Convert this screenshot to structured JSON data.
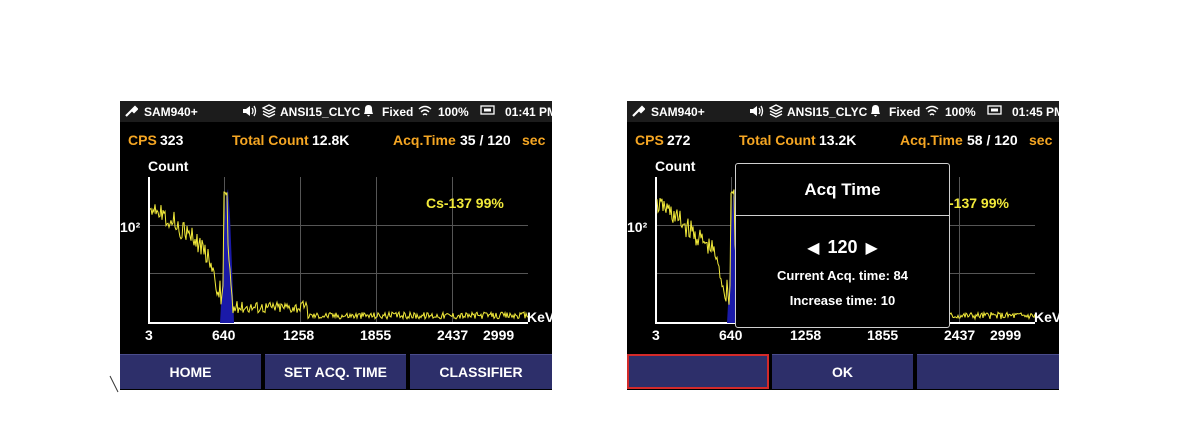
{
  "screens": [
    {
      "status": {
        "device": "SAM940+",
        "library": "ANSI15_CLYC",
        "mode": "Fixed",
        "battery": "100%",
        "time": "01:41 PM"
      },
      "metrics": {
        "cps_label": "CPS",
        "cps_value": "323",
        "total_label": "Total Count",
        "total_value": "12.8K",
        "acq_label": "Acq.Time",
        "acq_value": "35 / 120",
        "acq_unit": "sec"
      },
      "plot": {
        "y_title": "Count",
        "y_tick": "10²",
        "x_unit": "KeV",
        "x_ticks": [
          "3",
          "640",
          "1258",
          "1855",
          "2437",
          "2999"
        ],
        "nuclide": "Cs-137 99%"
      },
      "softkeys": [
        "HOME",
        "SET ACQ. TIME",
        "CLASSIFIER"
      ]
    },
    {
      "status": {
        "device": "SAM940+",
        "library": "ANSI15_CLYC",
        "mode": "Fixed",
        "battery": "100%",
        "time": "01:45 PM"
      },
      "metrics": {
        "cps_label": "CPS",
        "cps_value": "272",
        "total_label": "Total Count",
        "total_value": "13.2K",
        "acq_label": "Acq.Time",
        "acq_value": "58 / 120",
        "acq_unit": "sec"
      },
      "plot": {
        "y_title": "Count",
        "y_tick": "10²",
        "x_unit": "KeV",
        "x_ticks": [
          "3",
          "640",
          "1258",
          "1855",
          "2437",
          "2999"
        ],
        "nuclide": "-137 99%"
      },
      "dialog": {
        "title": "Acq Time",
        "value": "120",
        "current": "Current Acq. time: 84",
        "increase": "Increase time: 10"
      },
      "softkeys": [
        "",
        "OK",
        ""
      ]
    }
  ],
  "colors": {
    "accent": "#f5a623",
    "nuclide": "#f2ea3a",
    "spectrum": "#f2ea3a",
    "peak_fill": "#1a1aa8",
    "softkey_bg": "#2d2f6a",
    "selection": "#d32a2a"
  },
  "icons": [
    "wrench-icon",
    "speaker-icon",
    "library-icon",
    "bell-icon",
    "wifi-icon",
    "battery-icon",
    "left-arrow-icon",
    "right-arrow-icon"
  ]
}
